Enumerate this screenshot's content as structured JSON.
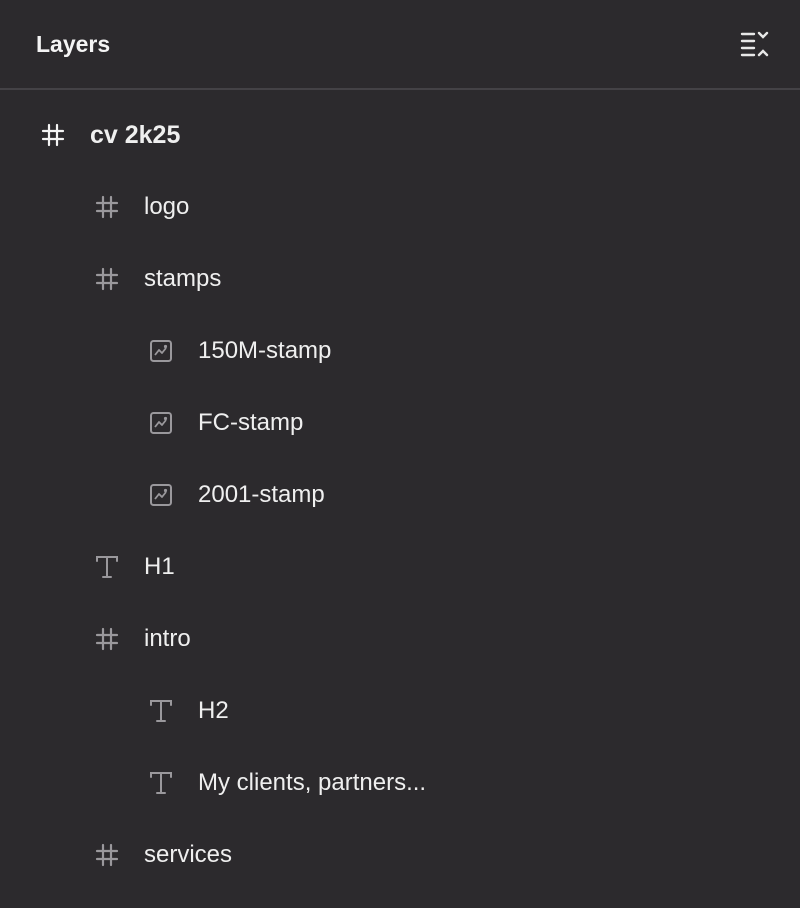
{
  "panel": {
    "title": "Layers",
    "collapse_icon": "collapse-all-icon"
  },
  "layers": [
    {
      "name": "cv 2k25",
      "type": "frame",
      "icon": "frame-icon",
      "depth": 0
    },
    {
      "name": "logo",
      "type": "frame",
      "icon": "frame-icon",
      "depth": 1
    },
    {
      "name": "stamps",
      "type": "frame",
      "icon": "frame-icon",
      "depth": 1
    },
    {
      "name": "150M-stamp",
      "type": "image",
      "icon": "image-icon",
      "depth": 2
    },
    {
      "name": "FC-stamp",
      "type": "image",
      "icon": "image-icon",
      "depth": 2
    },
    {
      "name": "2001-stamp",
      "type": "image",
      "icon": "image-icon",
      "depth": 2
    },
    {
      "name": "H1",
      "type": "text",
      "icon": "text-icon",
      "depth": 1
    },
    {
      "name": "intro",
      "type": "frame",
      "icon": "frame-icon",
      "depth": 1
    },
    {
      "name": "H2",
      "type": "text",
      "icon": "text-icon",
      "depth": 2
    },
    {
      "name": "My clients, partners...",
      "type": "text",
      "icon": "text-icon",
      "depth": 2
    },
    {
      "name": "services",
      "type": "frame",
      "icon": "frame-icon",
      "depth": 1
    }
  ],
  "colors": {
    "background": "#2c2a2d",
    "divider": "#444246",
    "text": "#efefef",
    "icon_root": "#f4f4f4",
    "icon_child": "#9a989c"
  }
}
